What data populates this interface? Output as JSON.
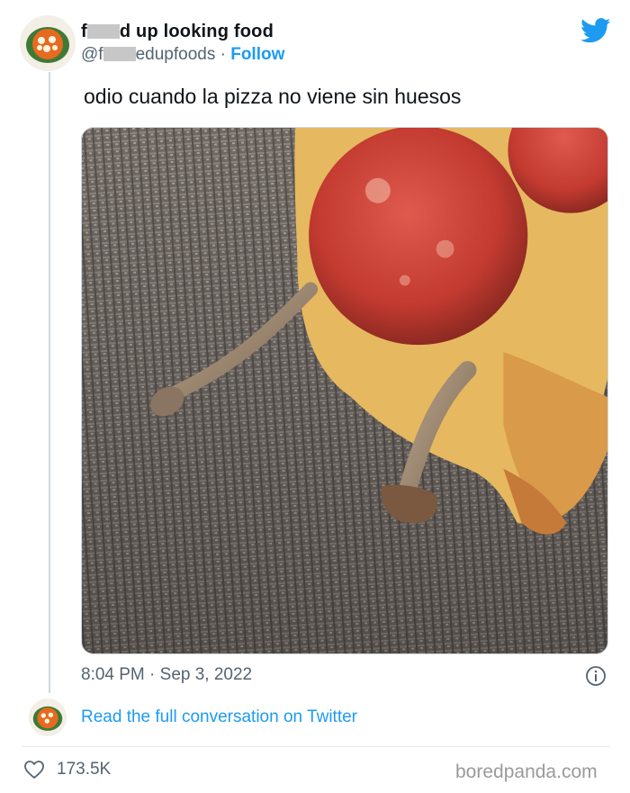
{
  "tweet": {
    "display_name_start": "f",
    "display_name_end": "d up looking food",
    "handle_start": "@f",
    "handle_end": "edupfoods",
    "handle_separator": " · ",
    "follow_label": "Follow",
    "text": "odio cuando la pizza no viene sin huesos",
    "timestamp": "8:04 PM · Sep 3, 2022",
    "read_more_label": "Read the full conversation on Twitter",
    "like_count": "173.5K"
  },
  "footer": {
    "watermark": "boredpanda.com"
  },
  "colors": {
    "accent": "#1d9bf0",
    "secondary_text": "#536471",
    "primary_text": "#0f1419"
  },
  "icons": {
    "brand": "twitter-bird-icon",
    "info": "info-icon",
    "like": "heart-icon"
  }
}
